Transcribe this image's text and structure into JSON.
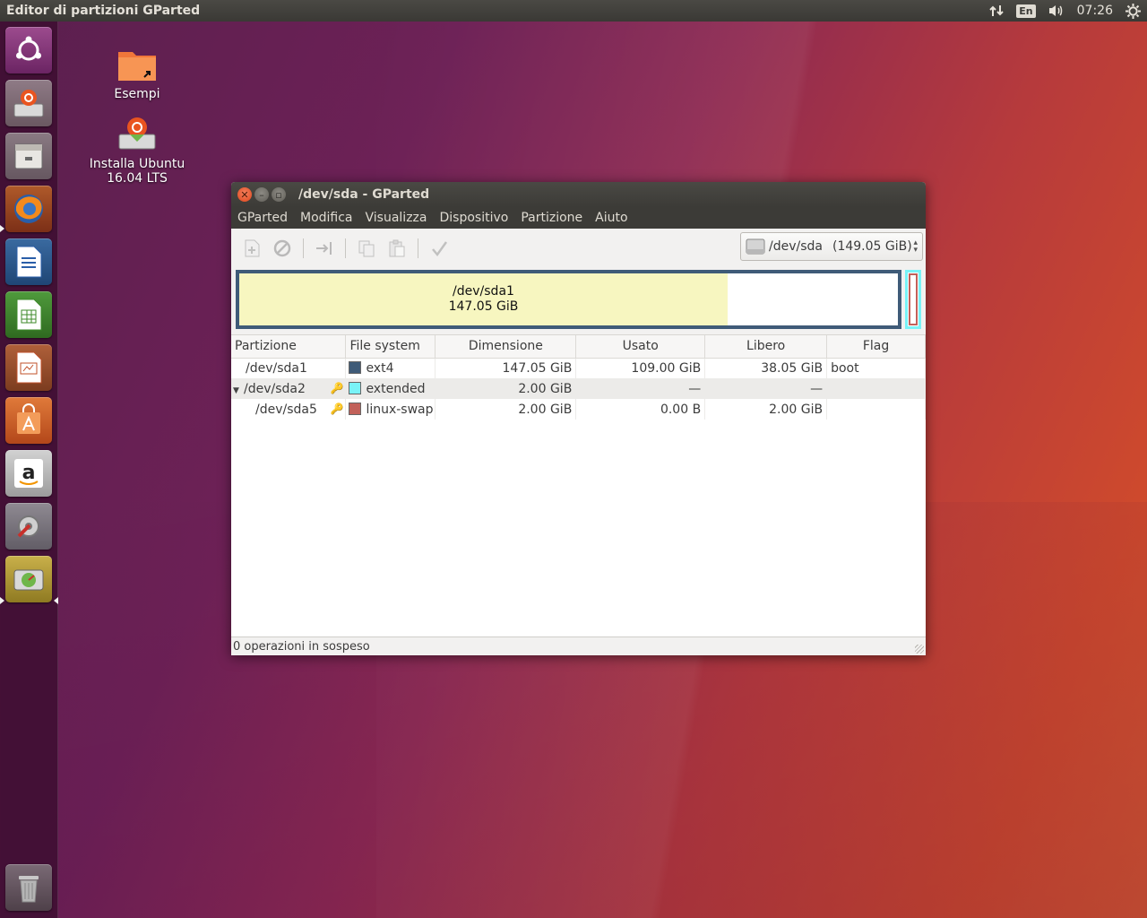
{
  "top_panel": {
    "app_title": "Editor di partizioni GParted",
    "lang": "En",
    "time": "07:26"
  },
  "desktop": {
    "icons": [
      {
        "label": "Esempi"
      },
      {
        "label_line1": "Installa Ubuntu",
        "label_line2": "16.04 LTS"
      }
    ]
  },
  "window": {
    "title": "/dev/sda - GParted",
    "menu": [
      "GParted",
      "Modifica",
      "Visualizza",
      "Dispositivo",
      "Partizione",
      "Aiuto"
    ],
    "device_selector": {
      "device": "/dev/sda",
      "size": "(149.05 GiB)"
    },
    "disk_graphic": {
      "partition_name": "/dev/sda1",
      "partition_size": "147.05 GiB",
      "used_fraction": 0.741,
      "colors": {
        "ext4": "#3f5b78",
        "extended": "#79f3f7",
        "linux-swap": "#c2615a",
        "used": "#f7f6c0"
      }
    },
    "table": {
      "headers": [
        "Partizione",
        "File system",
        "Dimensione",
        "Usato",
        "Libero",
        "Flag"
      ],
      "rows": [
        {
          "partition": "/dev/sda1",
          "fs": "ext4",
          "fs_color": "#3f5b78",
          "size": "147.05 GiB",
          "used": "109.00 GiB",
          "free": "38.05 GiB",
          "flag": "boot"
        },
        {
          "partition": "/dev/sda2",
          "fs": "extended",
          "fs_color": "#79f3f7",
          "size": "2.00 GiB",
          "used": "—",
          "free": "—",
          "flag": ""
        },
        {
          "partition": "/dev/sda5",
          "fs": "linux-swap",
          "fs_color": "#c2615a",
          "size": "2.00 GiB",
          "used": "0.00 B",
          "free": "2.00 GiB",
          "flag": ""
        }
      ]
    },
    "status": "0 operazioni in sospeso"
  }
}
